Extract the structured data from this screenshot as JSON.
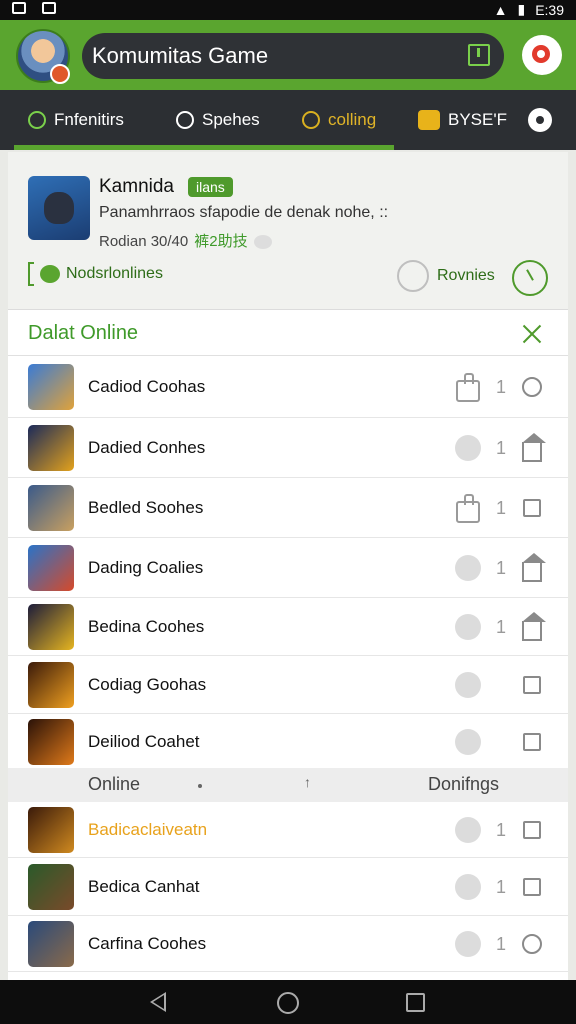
{
  "status_bar": {
    "time": "E:39"
  },
  "header": {
    "title": "Komumitas Game"
  },
  "tabs": [
    {
      "label": "Fnfenitirs",
      "active": true
    },
    {
      "label": "Spehes"
    },
    {
      "label": "colling"
    },
    {
      "label": "BYSE'F"
    }
  ],
  "community": {
    "name": "Kamnida",
    "badge": "ilans",
    "description": "Panamhrraos sfapodie de denak nohe, ::",
    "meta_text": "Rodian 30/40",
    "meta_green": "裤2助技",
    "online_label": "Nodsrlonlines",
    "reviews_label": "Rovnies"
  },
  "list": {
    "title": "Dalat Online",
    "rows": [
      {
        "label": "Cadiod Coohas",
        "count": "1",
        "indicator": "like",
        "action": "chat"
      },
      {
        "label": "Dadied Conhes",
        "count": "1",
        "indicator": "dot",
        "action": "home"
      },
      {
        "label": "Bedled Soohes",
        "count": "1",
        "indicator": "like",
        "action": "square"
      },
      {
        "label": "Dading Coalies",
        "count": "1",
        "indicator": "dot",
        "action": "home"
      },
      {
        "label": "Bedina Coohes",
        "count": "1",
        "indicator": "dot",
        "action": "home"
      },
      {
        "label": "Codiag Goohas",
        "count": "",
        "indicator": "dot",
        "action": "square"
      },
      {
        "label": "Deiliod Coahet",
        "count": "",
        "indicator": "dot",
        "action": "square"
      }
    ]
  },
  "section": {
    "left": "Online",
    "mid": "↑",
    "right": "Donifngs"
  },
  "list2": {
    "rows": [
      {
        "label": "Badicaclaiveatn",
        "count": "1",
        "indicator": "dot",
        "action": "square",
        "highlight": true
      },
      {
        "label": "Bedica Canhat",
        "count": "1",
        "indicator": "dot",
        "action": "square"
      },
      {
        "label": "Carfina Coohes",
        "count": "1",
        "indicator": "dot",
        "action": "chat"
      }
    ]
  },
  "colors": {
    "accent": "#5aa52f",
    "tab_bar": "#2c2f33",
    "highlight": "#e8a21c"
  },
  "icons": [
    "back-icon",
    "home-icon",
    "recent-apps-icon",
    "notification-icon",
    "gear-icon"
  ]
}
